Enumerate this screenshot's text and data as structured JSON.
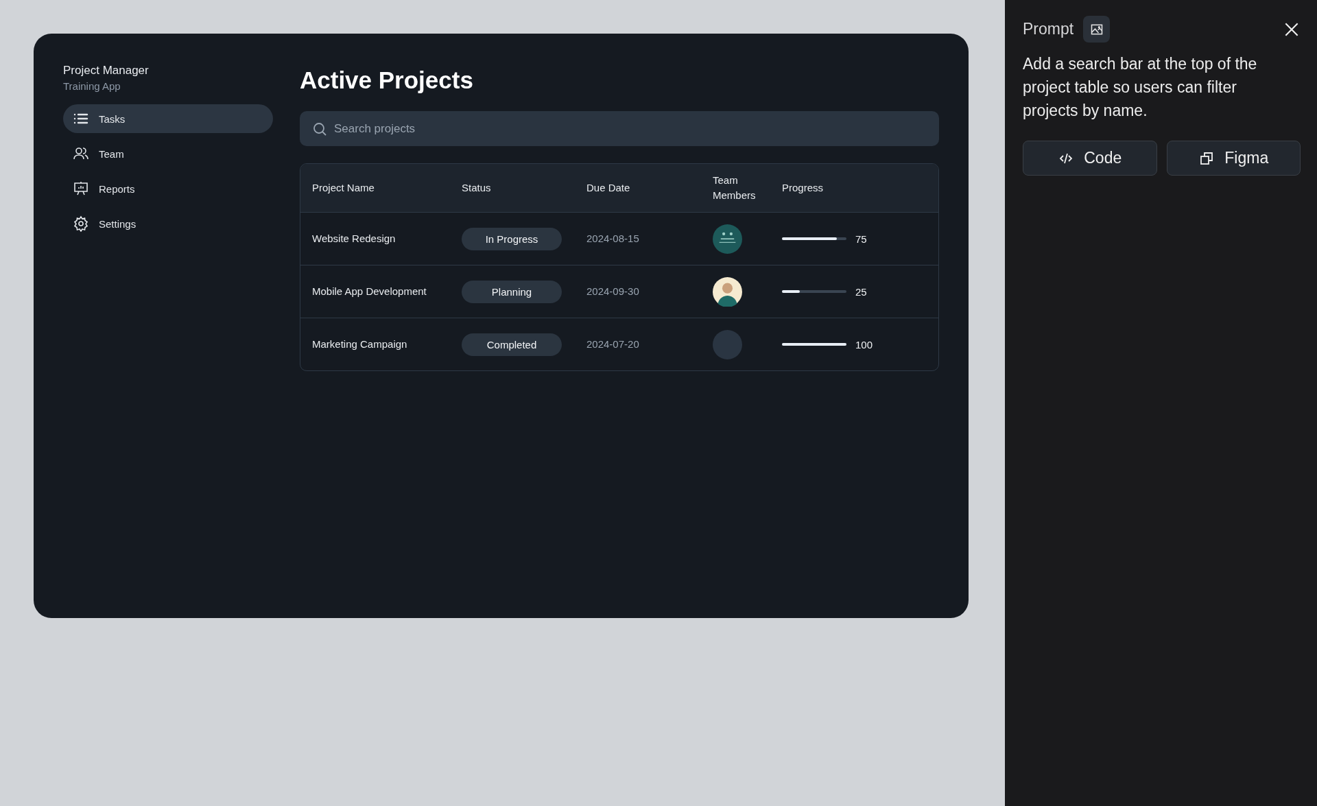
{
  "app": {
    "title": "Project Manager",
    "subtitle": "Training App"
  },
  "sidebar": {
    "items": [
      {
        "label": "Tasks",
        "kind": "list",
        "selected": true
      },
      {
        "label": "Team",
        "kind": "team",
        "selected": false
      },
      {
        "label": "Reports",
        "kind": "reports",
        "selected": false
      },
      {
        "label": "Settings",
        "kind": "settings",
        "selected": false
      }
    ]
  },
  "page_title": "Active Projects",
  "search": {
    "placeholder": "Search projects"
  },
  "table": {
    "columns": [
      "Project Name",
      "Status",
      "Due Date",
      "Team Members",
      "Progress"
    ],
    "rows": [
      {
        "name": "Website Redesign",
        "status": "In Progress",
        "due": "2024-08-15",
        "avatar": {
          "kind": "badge",
          "color": "#1d5a5a"
        },
        "level": 0.85,
        "reading": "75"
      },
      {
        "name": "Mobile App Development",
        "status": "Planning",
        "due": "2024-09-30",
        "avatar": {
          "kind": "person",
          "color": "#f5ead0"
        },
        "level": 0.28,
        "reading": "25"
      },
      {
        "name": "Marketing Campaign",
        "status": "Completed",
        "due": "2024-07-20",
        "avatar": {
          "kind": "plain",
          "color": "#2a3542"
        },
        "level": 1,
        "reading": "100"
      }
    ]
  },
  "prompt_panel": {
    "title": "Prompt",
    "text": "Add a search bar at the top of the project table so users can filter projects by name.",
    "buttons": [
      {
        "label": "Code",
        "kind": "code"
      },
      {
        "label": "Figma",
        "kind": "copy"
      }
    ]
  }
}
